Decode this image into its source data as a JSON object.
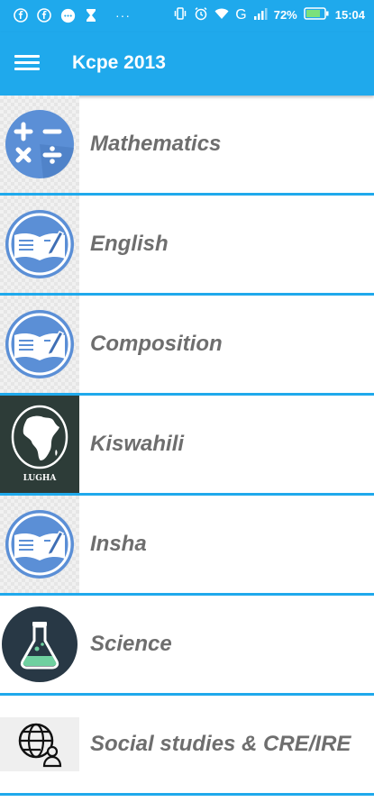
{
  "status": {
    "battery_percent": "72%",
    "time": "15:04",
    "dots": "···",
    "network": "G"
  },
  "appbar": {
    "title": "Kcpe 2013",
    "menu_icon": "hamburger-menu-icon"
  },
  "subjects": [
    {
      "label": "Mathematics",
      "icon": "math-operators-icon"
    },
    {
      "label": "English",
      "icon": "open-book-pen-icon"
    },
    {
      "label": "Composition",
      "icon": "open-book-pen-icon"
    },
    {
      "label": "Kiswahili",
      "icon": "africa-map-icon",
      "icon_caption": "LUGHA"
    },
    {
      "label": "Insha",
      "icon": "open-book-pen-icon"
    },
    {
      "label": "Science",
      "icon": "flask-icon"
    },
    {
      "label": "Social studies & CRE/IRE",
      "icon": "globe-person-icon"
    }
  ],
  "colors": {
    "primary": "#1fa9ec",
    "label_text": "#6e6e6e",
    "icon_blue": "#5b8fd6",
    "science_bg": "#283845"
  }
}
